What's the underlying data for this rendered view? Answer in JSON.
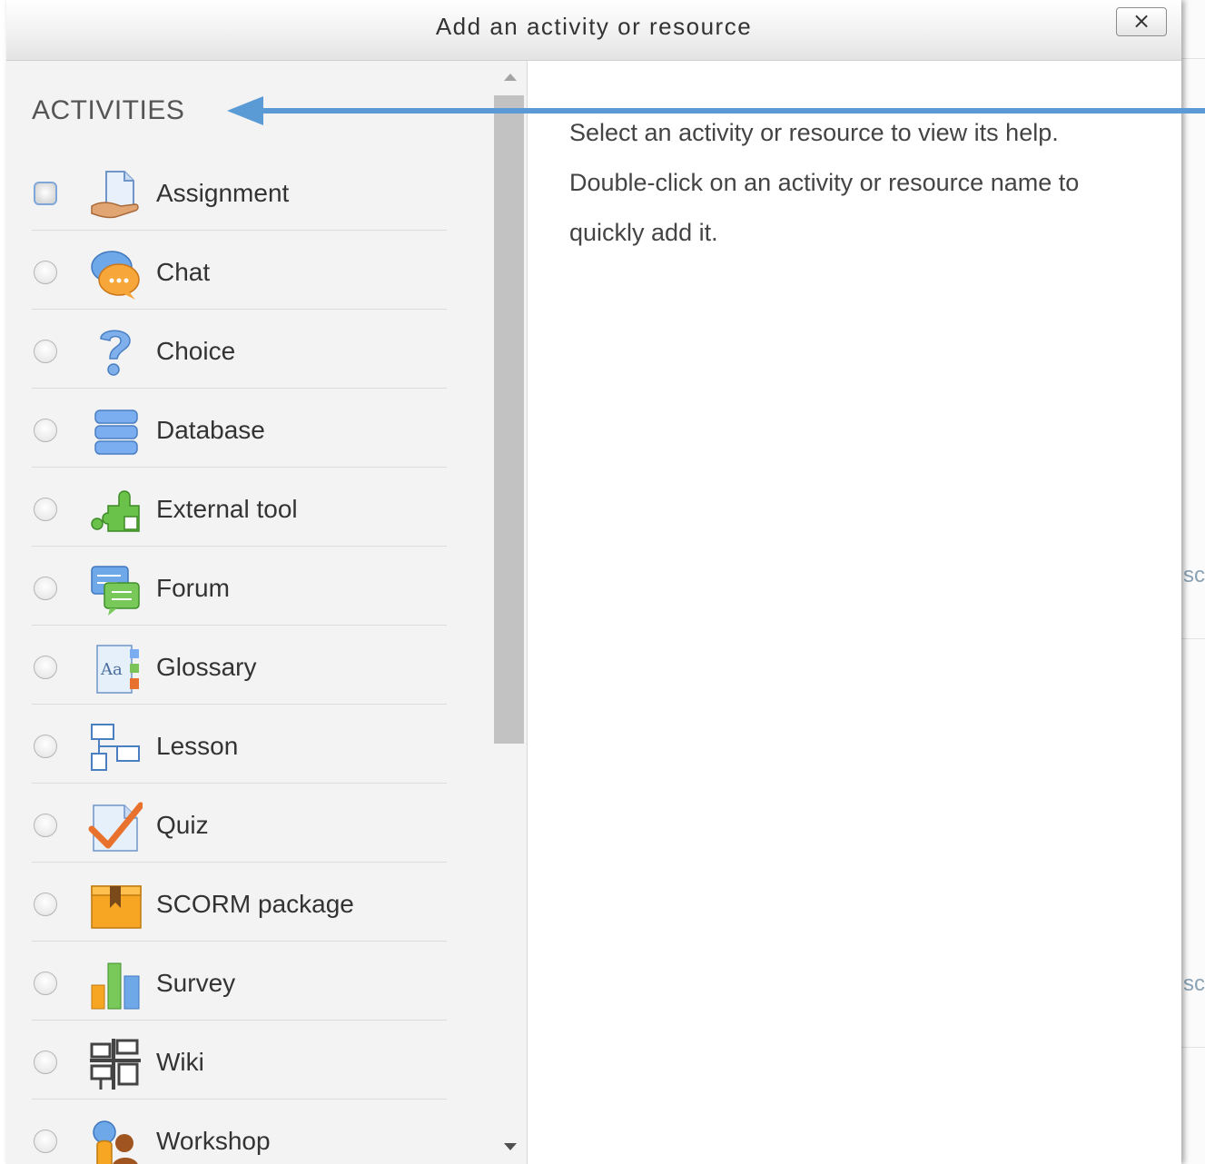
{
  "dialog": {
    "title": "Add an activity or resource",
    "close_label": "×"
  },
  "activities": {
    "heading": "ACTIVITIES",
    "items": [
      {
        "label": "Assignment",
        "icon": "assignment-icon",
        "selected": false,
        "focused": true
      },
      {
        "label": "Chat",
        "icon": "chat-icon",
        "selected": false
      },
      {
        "label": "Choice",
        "icon": "choice-icon",
        "selected": false
      },
      {
        "label": "Database",
        "icon": "database-icon",
        "selected": false
      },
      {
        "label": "External tool",
        "icon": "external-tool-icon",
        "selected": false
      },
      {
        "label": "Forum",
        "icon": "forum-icon",
        "selected": false
      },
      {
        "label": "Glossary",
        "icon": "glossary-icon",
        "selected": false
      },
      {
        "label": "Lesson",
        "icon": "lesson-icon",
        "selected": false
      },
      {
        "label": "Quiz",
        "icon": "quiz-icon",
        "selected": false
      },
      {
        "label": "SCORM package",
        "icon": "scorm-package-icon",
        "selected": false
      },
      {
        "label": "Survey",
        "icon": "survey-icon",
        "selected": false
      },
      {
        "label": "Wiki",
        "icon": "wiki-icon",
        "selected": false
      },
      {
        "label": "Workshop",
        "icon": "workshop-icon",
        "selected": false
      }
    ]
  },
  "help": {
    "line1": "Select an activity or resource to view its help.",
    "line2": "Double-click on an activity or resource name to quickly add it."
  },
  "background_page": {
    "fragment_1": "sc",
    "fragment_2": "sc"
  },
  "colors": {
    "arrow": "#5b9bd5",
    "panel_bg": "#f3f3f3",
    "focus_ring": "#7ea6d8"
  }
}
